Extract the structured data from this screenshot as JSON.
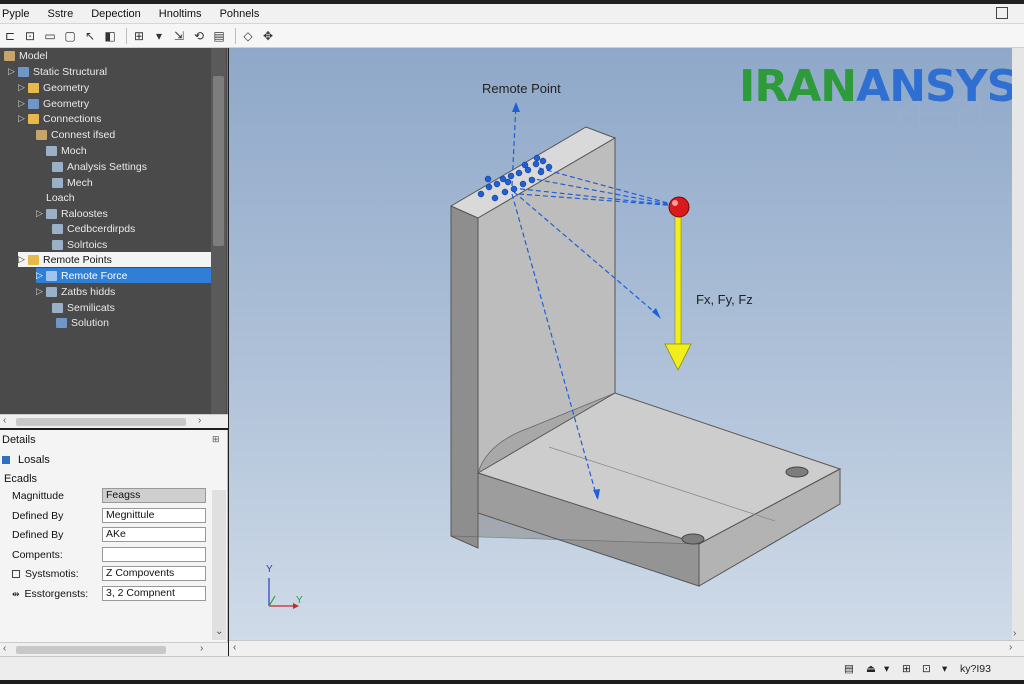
{
  "menu": [
    "Pyple",
    "Sstre",
    "Depection",
    "Hnoltims",
    "Pohnels"
  ],
  "tree": {
    "items": [
      {
        "label": "Model"
      },
      {
        "label": "Static Structural"
      },
      {
        "label": "Geometry"
      },
      {
        "label": "Geometry"
      },
      {
        "label": "Connections"
      },
      {
        "label": "Connest ifsed"
      },
      {
        "label": "Moch"
      },
      {
        "label": "Analysis Settings"
      },
      {
        "label": "Mech"
      },
      {
        "label": "Loach"
      },
      {
        "label": "Raloostes"
      },
      {
        "label": "Cedbcerdirpds"
      },
      {
        "label": "Solrtoics"
      },
      {
        "label": "Remote Points"
      },
      {
        "label": "Remote Force"
      },
      {
        "label": "Zatbs hidds"
      },
      {
        "label": "Semilicats"
      },
      {
        "label": "Solution"
      }
    ]
  },
  "details": {
    "title": "Details",
    "group": "Losals",
    "subgroup": "Ecadls",
    "rows": [
      {
        "label": "Magnittude",
        "value": "Feagss"
      },
      {
        "label": "Defined By",
        "value": "Megnittule"
      },
      {
        "label": "Defined By",
        "value": "AKe"
      },
      {
        "label": "Compents:",
        "value": ""
      },
      {
        "label": "Systsmotis:",
        "value": "Z Compovents"
      },
      {
        "label": "Esstorgensts:",
        "value": "3, 2 Compnent"
      }
    ]
  },
  "viewport": {
    "remote_point_label": "Remote Point",
    "force_label": "Fx, Fy, Fz",
    "logo": {
      "part1": "IRAN",
      "part2": "ANSYS"
    },
    "triad": {
      "y": "Y",
      "x": "Y"
    },
    "colors": {
      "sphere": "#d91a1a",
      "arrow": "#f2ee1c",
      "dots": "#1f5fd8"
    }
  },
  "status": {
    "right_text": "ky?I93"
  }
}
